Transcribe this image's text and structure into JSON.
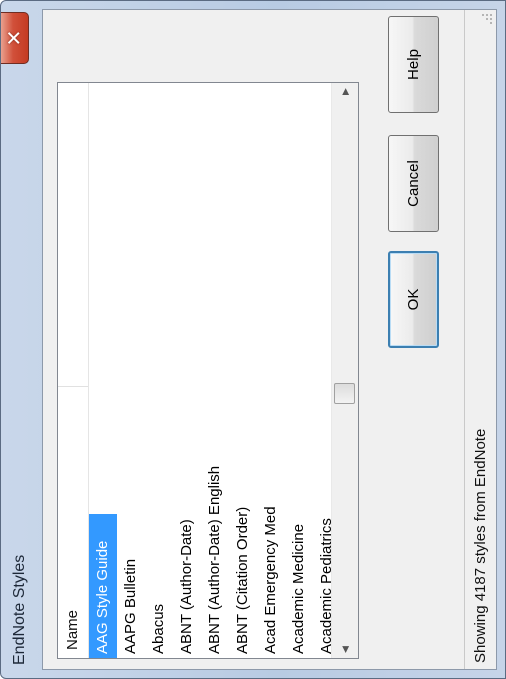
{
  "window": {
    "title": "EndNote Styles",
    "close_glyph": "✕"
  },
  "list": {
    "column_header": "Name",
    "items": [
      "AAG Style Guide",
      "AAPG Bulletin",
      "Abacus",
      "ABNT (Author-Date)",
      "ABNT (Author-Date) English",
      "ABNT (Citation Order)",
      "Acad Emergency Med",
      "Academic Medicine",
      "Academic Pediatrics"
    ],
    "selected_index": 0,
    "scroll_left_glyph": "◀",
    "scroll_right_glyph": "▶"
  },
  "buttons": {
    "ok": "OK",
    "cancel": "Cancel",
    "help": "Help"
  },
  "status": {
    "text": "Showing 4187 styles from EndNote"
  },
  "colors": {
    "selection": "#3399ff",
    "close_button": "#c43b22",
    "default_button_border": "#3c7fb1"
  }
}
